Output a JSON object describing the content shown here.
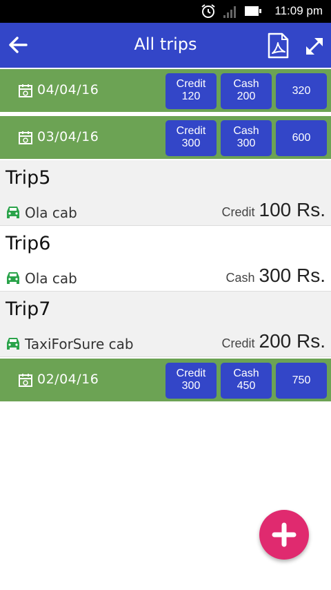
{
  "status_bar": {
    "time": "11:09 pm"
  },
  "app_bar": {
    "title": "All trips"
  },
  "days": [
    {
      "date": "04/04/16",
      "credit_label": "Credit",
      "credit": "120",
      "cash_label": "Cash",
      "cash": "200",
      "total": "320"
    },
    {
      "date": "03/04/16",
      "credit_label": "Credit",
      "credit": "300",
      "cash_label": "Cash",
      "cash": "300",
      "total": "600"
    },
    {
      "date": "02/04/16",
      "credit_label": "Credit",
      "credit": "300",
      "cash_label": "Cash",
      "cash": "450",
      "total": "750"
    }
  ],
  "trips": [
    {
      "name": "Trip5",
      "cab": "Ola cab",
      "mode": "Credit",
      "amount": "100 Rs."
    },
    {
      "name": "Trip6",
      "cab": "Ola cab",
      "mode": "Cash",
      "amount": "300 Rs."
    },
    {
      "name": "Trip7",
      "cab": "TaxiForSure cab",
      "mode": "Credit",
      "amount": "200 Rs."
    }
  ],
  "icons": {
    "back": "arrow-left-icon",
    "pdf": "pdf-icon",
    "expand": "expand-icon",
    "calendar": "calendar-icon",
    "car": "car-icon",
    "add": "plus-icon"
  },
  "colors": {
    "primary": "#3346c8",
    "day_header": "#6ca354",
    "car_icon": "#2aa34a",
    "fab": "#e02a6f"
  }
}
